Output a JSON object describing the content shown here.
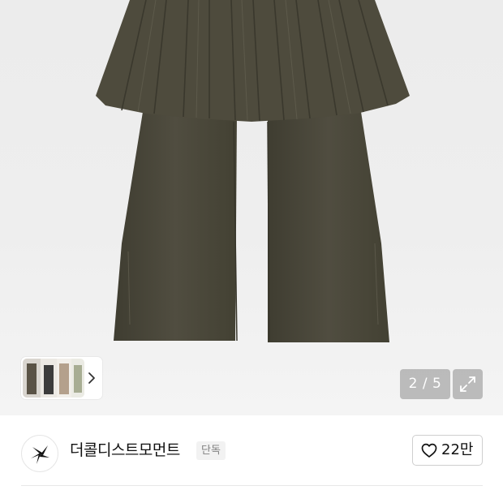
{
  "gallery": {
    "current_page": "2",
    "total_pages": "5",
    "counter_text": "2 / 5",
    "icons": {
      "thumbnails_next": "chevron-right-icon",
      "expand": "expand-arrows-icon"
    },
    "colors": {
      "garment": "#4c4a3c",
      "background": "#ededed",
      "overlay": "#8c8c8c"
    }
  },
  "shop": {
    "name": "더콜디스트모먼트",
    "badge": "단독",
    "logo_icon": "star-burst-logo-icon",
    "like_icon": "heart-outline-icon",
    "like_count": "22만"
  }
}
